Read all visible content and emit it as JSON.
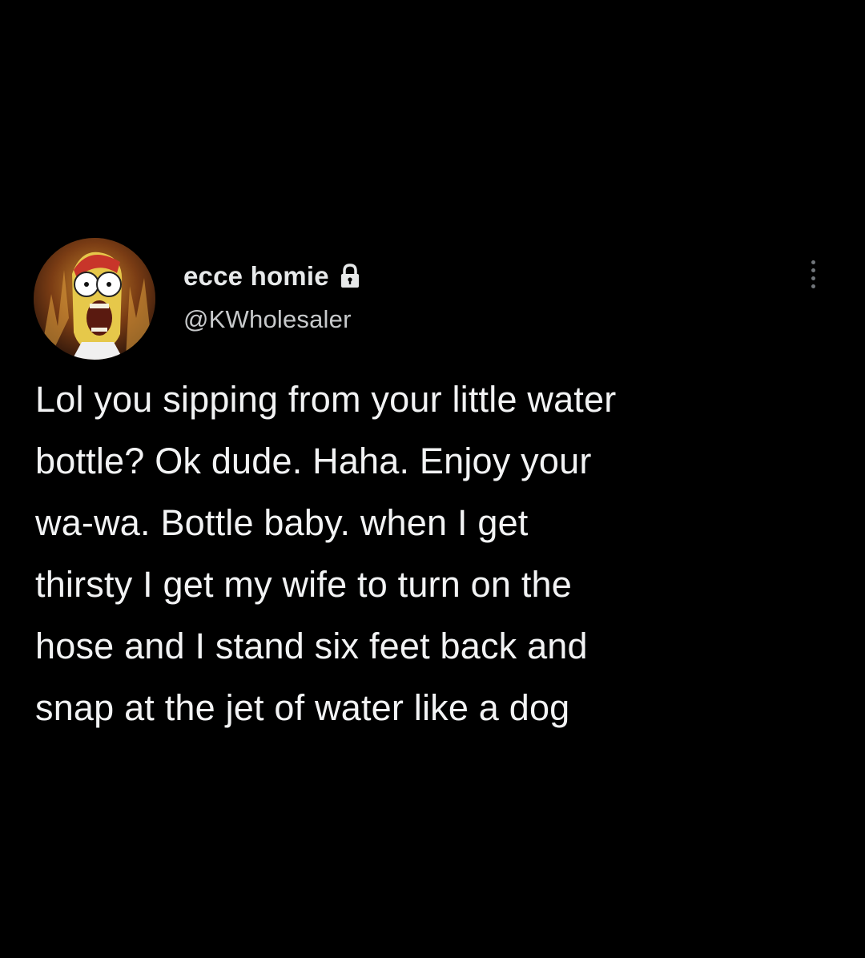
{
  "tweet": {
    "author": {
      "display_name": "ecce homie",
      "handle": "@KWholesaler",
      "protected_icon": "lock-icon",
      "avatar_icon": "cartoon-avatar"
    },
    "more_icon": "more-vertical-icon",
    "text_lines": [
      "Lol you sipping from your little water",
      "bottle? Ok dude. Haha. Enjoy your",
      "wa-wa. Bottle baby. when I get",
      "thirsty I get my wife to turn on the",
      "hose and I stand six feet back and",
      "snap at the jet of water like a dog"
    ]
  },
  "colors": {
    "background": "#000000",
    "primary_text": "#e7e9ea",
    "secondary_text": "#71767b"
  }
}
